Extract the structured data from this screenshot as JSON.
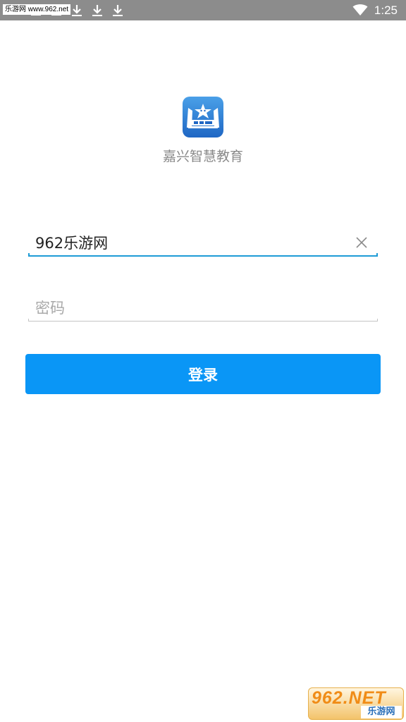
{
  "status_bar": {
    "watermark_text": "乐游网 www.962.net",
    "time": "1:25",
    "icons": [
      "minus-icon",
      "minus-icon",
      "download-icon",
      "download-icon",
      "download-icon",
      "wifi-icon"
    ]
  },
  "app": {
    "logo_icon": "app-logo-icon",
    "name": "嘉兴智慧教育",
    "brand_color": "#1f67c4"
  },
  "login_form": {
    "username_value": "962乐游网",
    "password_placeholder": "密码",
    "login_label": "登录",
    "accent_color": "#0a96f6",
    "focused_underline_color": "#1e9bd6"
  },
  "watermark": {
    "number_text": "962.NET",
    "site_text": "乐游网"
  }
}
